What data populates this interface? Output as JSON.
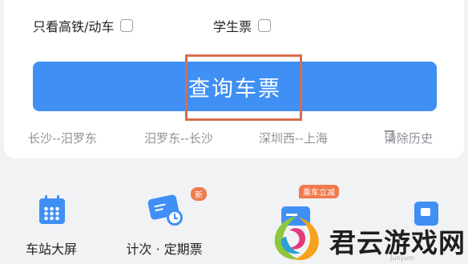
{
  "options": {
    "gaotie_label": "只看高铁/动车",
    "student_label": "学生票"
  },
  "query_button": {
    "label": "查询车票"
  },
  "history": {
    "items": [
      "长沙--汨罗东",
      "汨罗东--长沙",
      "深圳西--上海"
    ],
    "clear_label": "清除历史"
  },
  "shortcuts": [
    {
      "label": "车站大屏",
      "icon": "calendar-icon"
    },
    {
      "label": "计次 · 定期票",
      "icon": "ticket-clock-icon",
      "badge": "新"
    },
    {
      "label": "",
      "icon": "card-icon",
      "badge": "乘车立减"
    },
    {
      "label": "",
      "icon": "partial-icon"
    }
  ],
  "watermark": {
    "title": "君云游戏网",
    "subtitle": "Junyum"
  },
  "colors": {
    "accent": "#3f8ff5",
    "highlight": "#d96d4d",
    "badge": "#ee7a4d"
  }
}
